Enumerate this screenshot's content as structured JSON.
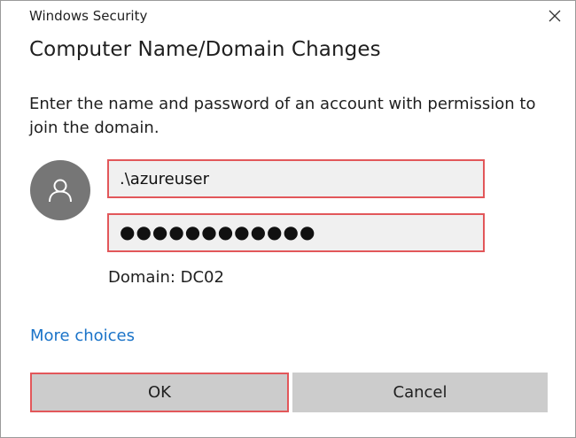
{
  "window": {
    "title": "Windows Security",
    "close_icon": "close-icon"
  },
  "dialog": {
    "heading": "Computer Name/Domain Changes",
    "description": "Enter the name and password of an account with permission to join the domain.",
    "avatar_icon": "user-icon",
    "username": {
      "value": ".\\azureuser",
      "highlighted": true
    },
    "password": {
      "value": "●●●●●●●●●●●●",
      "highlighted": true
    },
    "domain_label": "Domain: DC02",
    "more_choices": "More choices"
  },
  "buttons": {
    "ok": "OK",
    "cancel": "Cancel"
  },
  "colors": {
    "highlight": "#e2575a",
    "link": "#1a73c8",
    "avatar": "#767676",
    "button_bg": "#cccccc",
    "field_bg": "#f0f0f0"
  }
}
